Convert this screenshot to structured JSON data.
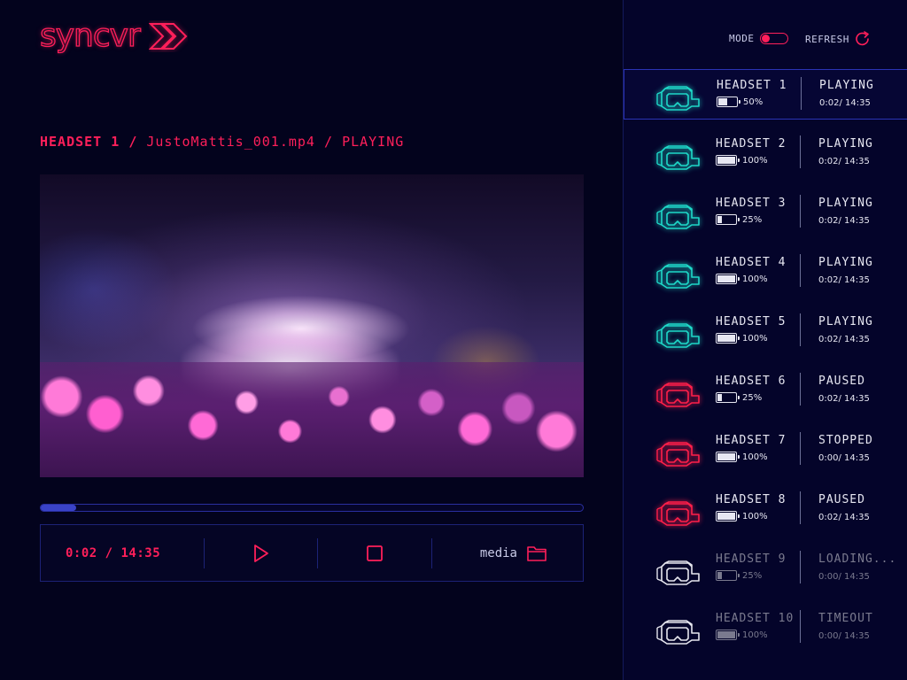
{
  "app": {
    "logo_text": "syncvr"
  },
  "breadcrumb": {
    "device": "HEADSET 1",
    "sep1": "/",
    "file": "JustoMattis_001.mp4",
    "sep2": "/",
    "state": "PLAYING"
  },
  "player": {
    "progress_fraction": 0.065,
    "time": "0:02 / 14:35",
    "media_label": "media"
  },
  "panel": {
    "mode_label": "MODE",
    "refresh_label": "REFRESH",
    "headsets": [
      {
        "name": "HEADSET 1",
        "battery": "50%",
        "battery_level": 0.5,
        "status": "PLAYING",
        "time": "0:02/ 14:35",
        "state": "playing",
        "selected": true
      },
      {
        "name": "HEADSET 2",
        "battery": "100%",
        "battery_level": 1.0,
        "status": "PLAYING",
        "time": "0:02/ 14:35",
        "state": "playing"
      },
      {
        "name": "HEADSET 3",
        "battery": "25%",
        "battery_level": 0.25,
        "status": "PLAYING",
        "time": "0:02/ 14:35",
        "state": "playing"
      },
      {
        "name": "HEADSET 4",
        "battery": "100%",
        "battery_level": 1.0,
        "status": "PLAYING",
        "time": "0:02/ 14:35",
        "state": "playing"
      },
      {
        "name": "HEADSET 5",
        "battery": "100%",
        "battery_level": 1.0,
        "status": "PLAYING",
        "time": "0:02/ 14:35",
        "state": "playing"
      },
      {
        "name": "HEADSET 6",
        "battery": "25%",
        "battery_level": 0.25,
        "status": "PAUSED",
        "time": "0:02/ 14:35",
        "state": "alert"
      },
      {
        "name": "HEADSET 7",
        "battery": "100%",
        "battery_level": 1.0,
        "status": "STOPPED",
        "time": "0:00/ 14:35",
        "state": "alert"
      },
      {
        "name": "HEADSET 8",
        "battery": "100%",
        "battery_level": 1.0,
        "status": "PAUSED",
        "time": "0:02/ 14:35",
        "state": "alert"
      },
      {
        "name": "HEADSET 9",
        "battery": "25%",
        "battery_level": 0.25,
        "status": "LOADING...",
        "time": "0:00/ 14:35",
        "state": "inactive"
      },
      {
        "name": "HEADSET 10",
        "battery": "100%",
        "battery_level": 1.0,
        "status": "TIMEOUT",
        "time": "0:00/ 14:35",
        "state": "inactive"
      }
    ]
  },
  "colors": {
    "accent": "#ff1f5a",
    "playing": "#1ed8c8",
    "alert": "#ff1f4a",
    "inactive": "#e6e6ee",
    "background": "#03031d",
    "panel": "#04042a"
  },
  "icons": {
    "logo": "double-chevron-icon",
    "play": "play-icon",
    "stop": "stop-icon",
    "media": "folder-icon",
    "refresh": "refresh-icon",
    "headset": "vr-headset-icon",
    "battery": "battery-icon"
  }
}
